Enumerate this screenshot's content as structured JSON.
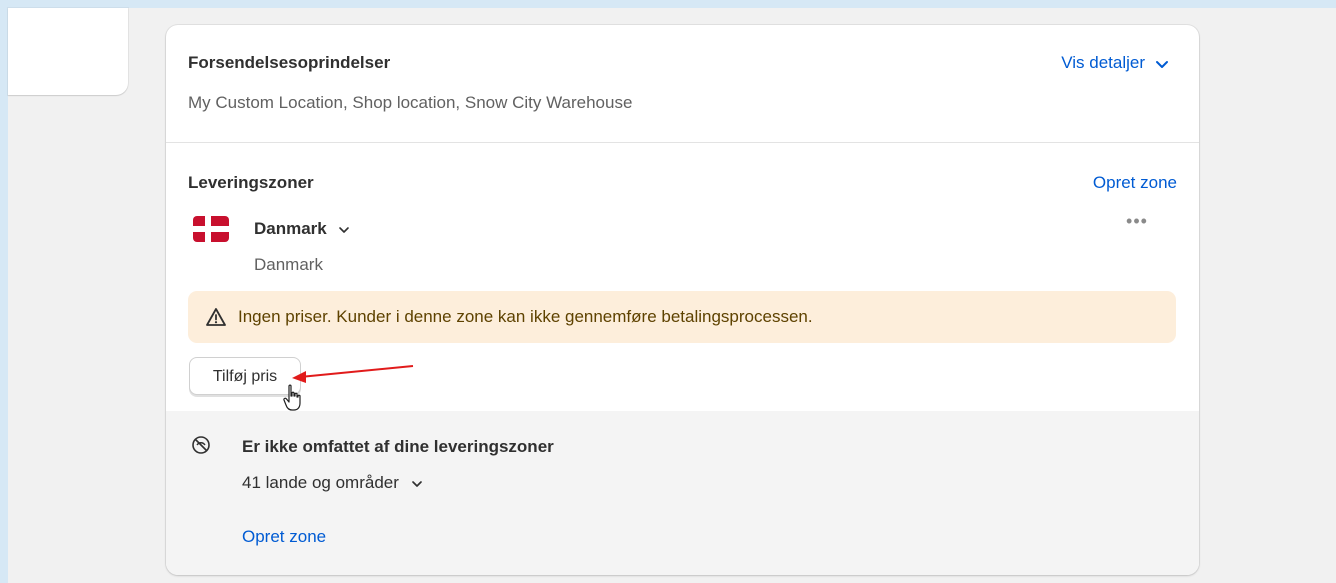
{
  "origins": {
    "title": "Forsendelsesoprindelser",
    "locations": "My Custom Location, Shop location, Snow City Warehouse",
    "details_link": "Vis detaljer"
  },
  "zones": {
    "title": "Leveringszoner",
    "create_link": "Opret zone",
    "zone": {
      "name": "Danmark",
      "countries": "Danmark",
      "flag_icon": "denmark-flag-icon",
      "more_icon": "ellipsis-icon"
    },
    "warning": "Ingen priser. Kunder i denne zone kan ikke gennemføre betalingsprocessen.",
    "add_rate_button": "Tilføj pris"
  },
  "not_covered": {
    "title": "Er ikke omfattet af dine leveringszoner",
    "count_text": "41 lande og områder",
    "create_link": "Opret zone"
  },
  "colors": {
    "link": "#005bd3",
    "warning_bg": "#fdeedb",
    "annotation_arrow": "#e11b1b"
  }
}
